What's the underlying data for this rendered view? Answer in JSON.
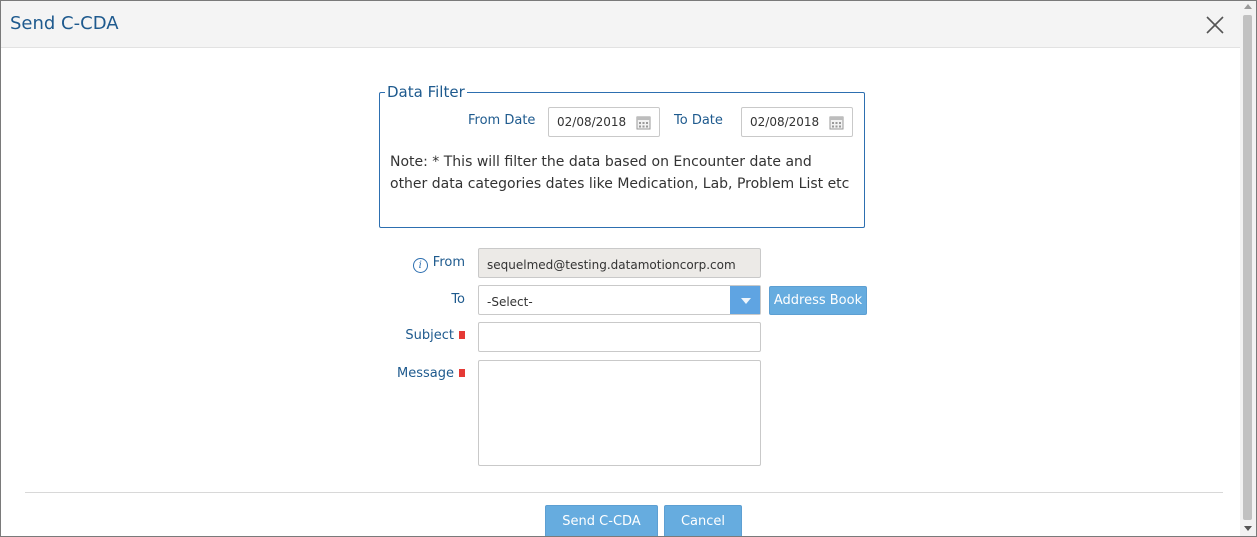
{
  "dialog": {
    "title": "Send C-CDA",
    "close_icon": "close-icon"
  },
  "data_filter": {
    "legend": "Data Filter",
    "from_date_label": "From Date",
    "from_date_value": "02/08/2018",
    "to_date_label": "To Date",
    "to_date_value": "02/08/2018",
    "calendar_icon": "calendar-icon",
    "note": "Note: * This will filter the data based on Encounter date and other data categories dates like Medication, Lab, Problem List etc"
  },
  "form": {
    "from_label": "From",
    "from_value": "sequelmed@testing.datamotioncorp.com",
    "info_icon": "info-icon",
    "to_label": "To",
    "to_value": "-Select-",
    "address_book_label": "Address Book",
    "subject_label": "Subject",
    "subject_value": "",
    "message_label": "Message",
    "message_value": ""
  },
  "footer": {
    "send_label": "Send C-CDA",
    "cancel_label": "Cancel"
  },
  "colors": {
    "accent": "#1e5a8e",
    "button": "#66acdf",
    "required": "#e53935"
  }
}
